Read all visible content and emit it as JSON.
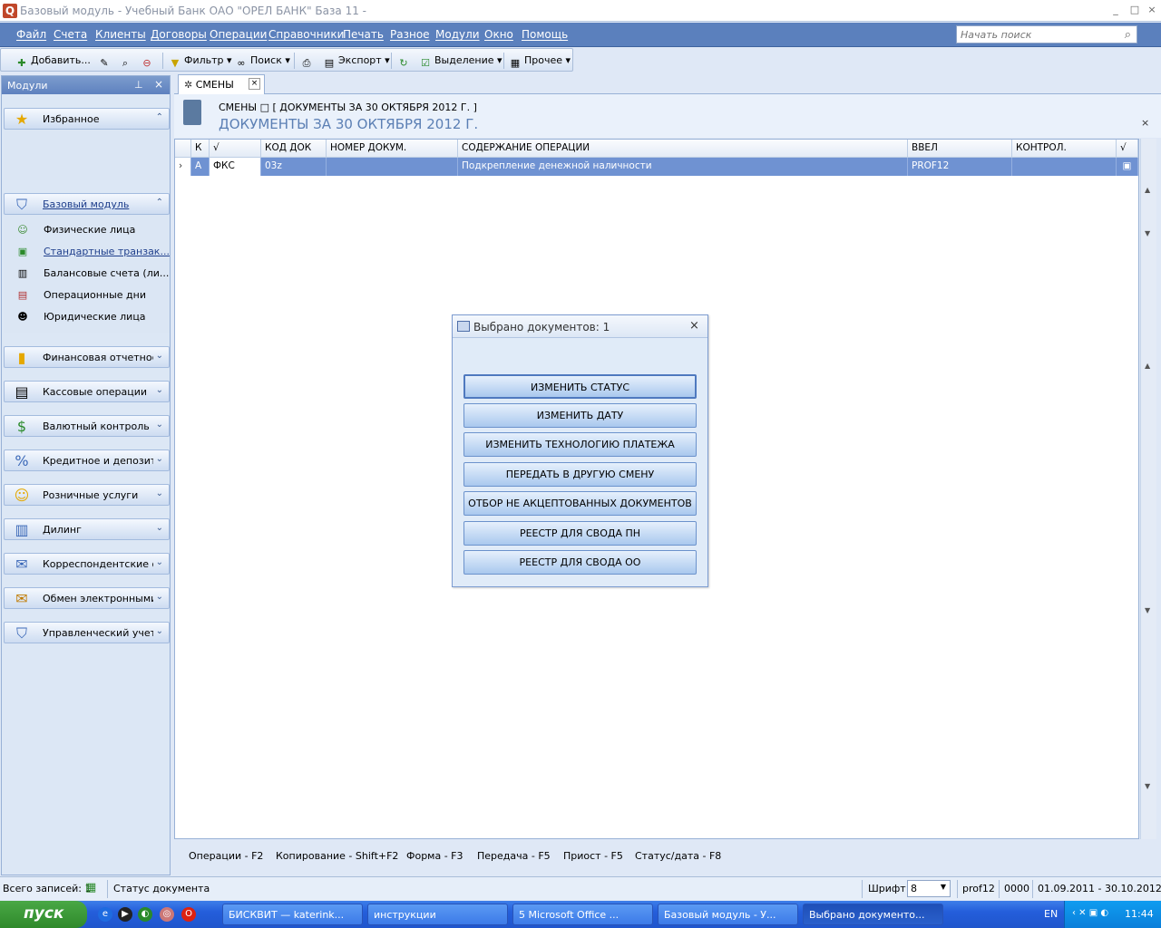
{
  "window": {
    "title": "Базовый модуль - Учебный Банк ОАО \"ОРЕЛ БАНК\" База 11 -",
    "min": "_",
    "max": "□",
    "close": "×"
  },
  "menu": [
    "Файл",
    "Счета",
    "Клиенты",
    "Договоры",
    "Операции",
    "Справочники",
    "Печать",
    "Разное",
    "Модули",
    "Окно",
    "Помощь"
  ],
  "search": {
    "placeholder": "Начать поиск"
  },
  "toolbar": {
    "add": "Добавить...",
    "filter": "Фильтр",
    "search": "Поиск",
    "export": "Экспорт",
    "select": "Выделение",
    "other": "Прочее"
  },
  "modules": {
    "header": "Модули",
    "favorites": "Избранное",
    "base_module": "Базовый модуль",
    "base_items": [
      "Физические лица",
      "Стандартные транзак...",
      "Балансовые счета (ли...",
      "Операционные дни",
      "Юридические лица"
    ],
    "groups": [
      "Финансовая отчетность",
      "Кассовые операции",
      "Валютный контроль",
      "Кредитное и депозитное",
      "Розничные услуги",
      "Дилинг",
      "Корреспондентские отн",
      "Обмен электронными д",
      "Управленческий учет"
    ]
  },
  "tab": {
    "label": "СМЕНЫ"
  },
  "header": {
    "crumb": "СМЕНЫ  □ [ ДОКУМЕНТЫ ЗА 30 ОКТЯБРЯ 2012 Г.  ]",
    "title": "ДОКУМЕНТЫ ЗА 30 ОКТЯБРЯ 2012 Г.",
    "close": "×"
  },
  "grid": {
    "columns": [
      "К",
      "√",
      "КОД ДОК",
      "НОМЕР ДОКУМ.",
      "СОДЕРЖАНИЕ ОПЕРАЦИИ",
      "ВВЕЛ",
      "КОНТРОЛ.",
      "√"
    ],
    "rows": [
      {
        "k": "А",
        "check": "ФКС",
        "code": "03z",
        "num": "",
        "content": "Подкрепление денежной наличности",
        "entered": "PROF12",
        "control": ""
      }
    ]
  },
  "fkeys": [
    "Операции - F2",
    "Копирование - Shift+F2",
    "Форма - F3",
    "Передача - F5",
    "Приост - F5",
    "Статус/дата - F8"
  ],
  "dialog": {
    "title": "Выбрано документов: 1",
    "close": "×",
    "buttons": [
      "ИЗМЕНИТЬ СТАТУС",
      "ИЗМЕНИТЬ ДАТУ",
      "ИЗМЕНИТЬ ТЕХНОЛОГИЮ ПЛАТЕЖА",
      "ПЕРЕДАТЬ В ДРУГУЮ СМЕНУ",
      "ОТБОР НЕ АКЦЕПТОВАННЫХ ДОКУМЕНТОВ",
      "РЕЕСТР ДЛЯ СВОДА ПН",
      "РЕЕСТР ДЛЯ СВОДА ОО"
    ]
  },
  "status": {
    "records": "Всего записей: 1",
    "doc_status": "Статус документа",
    "font_label": "Шрифт",
    "font_value": "8",
    "user": "prof12",
    "code": "0000",
    "period": "01.09.2011 - 30.10.2012"
  },
  "taskbar": {
    "start": "пуск",
    "items": [
      "БИСКВИТ — katerink...",
      "инструкции",
      "5 Microsoft Office ...",
      "Базовый модуль - У...",
      "Выбрано документо..."
    ],
    "lang": "EN",
    "time": "11:44"
  }
}
